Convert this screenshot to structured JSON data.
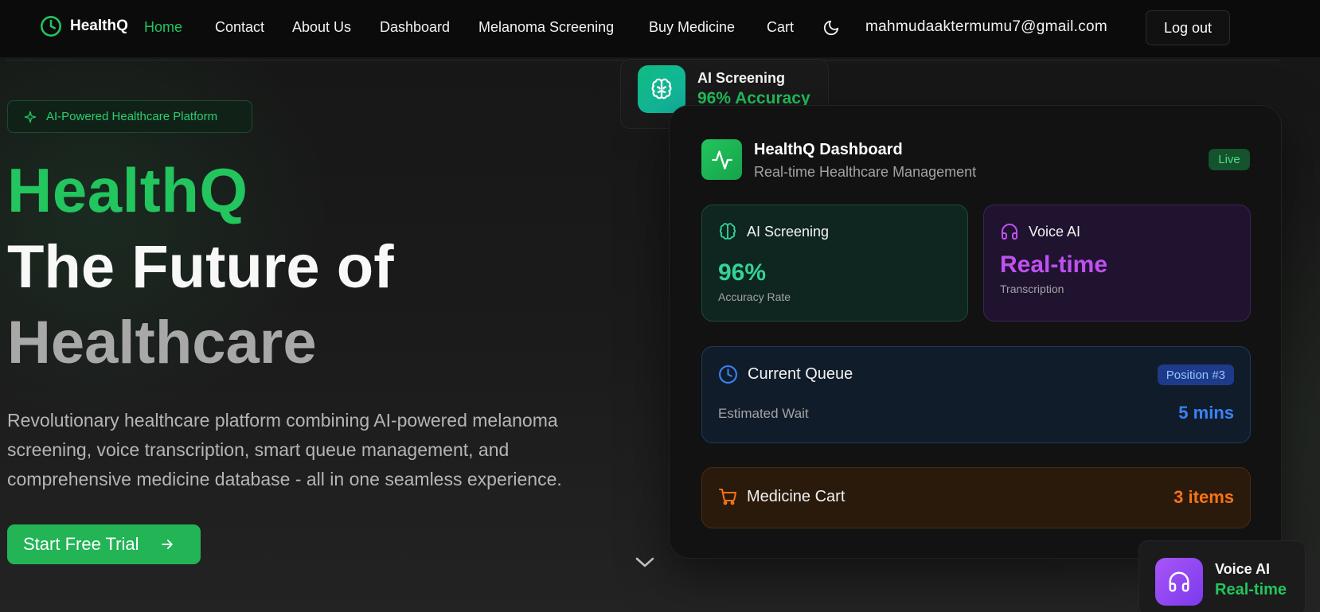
{
  "nav": {
    "brand": "HealthQ",
    "links": [
      "Home",
      "Contact",
      "About Us",
      "Dashboard",
      "Melanoma Screening",
      "Buy Medicine",
      "Cart"
    ],
    "active": "Home",
    "user_email": "mahmudaaktermumu7@gmail.com",
    "logout_label": "Log out"
  },
  "hero": {
    "badge": "AI-Powered Healthcare Platform",
    "title_line1": "HealthQ",
    "title_line2": "The Future of",
    "title_line3": "Healthcare",
    "description": "Revolutionary healthcare platform combining AI-powered melanoma screening, voice transcription, smart queue management, and comprehensive medicine database - all in one seamless experience.",
    "cta_label": "Start Free Trial"
  },
  "float_top": {
    "title": "AI Screening",
    "value": "96% Accuracy"
  },
  "dashboard": {
    "title": "HealthQ Dashboard",
    "subtitle": "Real-time Healthcare Management",
    "status": "Live",
    "ai_tile": {
      "label": "AI Screening",
      "value": "96%",
      "caption": "Accuracy Rate"
    },
    "voice_tile": {
      "label": "Voice AI",
      "value": "Real-time",
      "caption": "Transcription"
    },
    "queue": {
      "label": "Current Queue",
      "position": "Position #3",
      "wait_label": "Estimated Wait",
      "wait_value": "5 mins"
    },
    "cart": {
      "label": "Medicine Cart",
      "value": "3 items"
    }
  },
  "float_bottom": {
    "title": "Voice AI",
    "value": "Real-time"
  },
  "colors": {
    "accent": "#22c55e",
    "purple": "#c050f0",
    "blue": "#3b82f6",
    "orange": "#f97316"
  },
  "icons": [
    "clock-icon",
    "moon-icon",
    "sparkle-icon",
    "arrow-right-icon",
    "chevron-down-icon",
    "brain-icon",
    "activity-icon",
    "headphones-icon",
    "cart-icon"
  ]
}
